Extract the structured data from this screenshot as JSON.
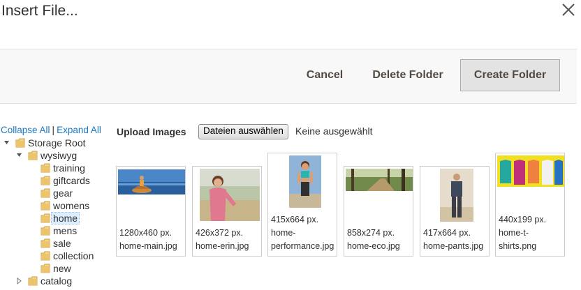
{
  "dialog": {
    "title": "Insert File..."
  },
  "toolbar": {
    "cancel_label": "Cancel",
    "delete_label": "Delete Folder",
    "create_label": "Create Folder"
  },
  "tree_controls": {
    "collapse_label": "Collapse All",
    "separator": "|",
    "expand_label": "Expand All"
  },
  "tree": {
    "root": "Storage Root",
    "wysiwyg": "wysiwyg",
    "children": [
      "training",
      "giftcards",
      "gear",
      "womens",
      "home",
      "mens",
      "sale",
      "collection",
      "new"
    ],
    "selected": "home",
    "catalog": "catalog"
  },
  "upload": {
    "label": "Upload Images",
    "button_label": "Dateien auswählen",
    "status": "Keine ausgewählt"
  },
  "files": [
    {
      "dims": "1280x460 px.",
      "name": "home-main.jpg",
      "icon": "yoga-beach-photo"
    },
    {
      "dims": "426x372 px.",
      "name": "home-erin.jpg",
      "icon": "woman-pink-photo"
    },
    {
      "dims": "415x664 px.",
      "name_line1": "home-",
      "name_line2": "performance.jpg",
      "icon": "fitness-woman-photo"
    },
    {
      "dims": "858x274 px.",
      "name": "home-eco.jpg",
      "icon": "forest-path-photo"
    },
    {
      "dims": "417x664 px.",
      "name": "home-pants.jpg",
      "icon": "man-pants-photo"
    },
    {
      "dims": "440x199 px.",
      "name_line1": "home-t-",
      "name_line2": "shirts.png",
      "icon": "tshirts-photo"
    }
  ],
  "colors": {
    "link": "#1979c3",
    "toolbar_bg": "#f8f8f8",
    "button_bg": "#e3e3e3",
    "text": "#303030"
  }
}
